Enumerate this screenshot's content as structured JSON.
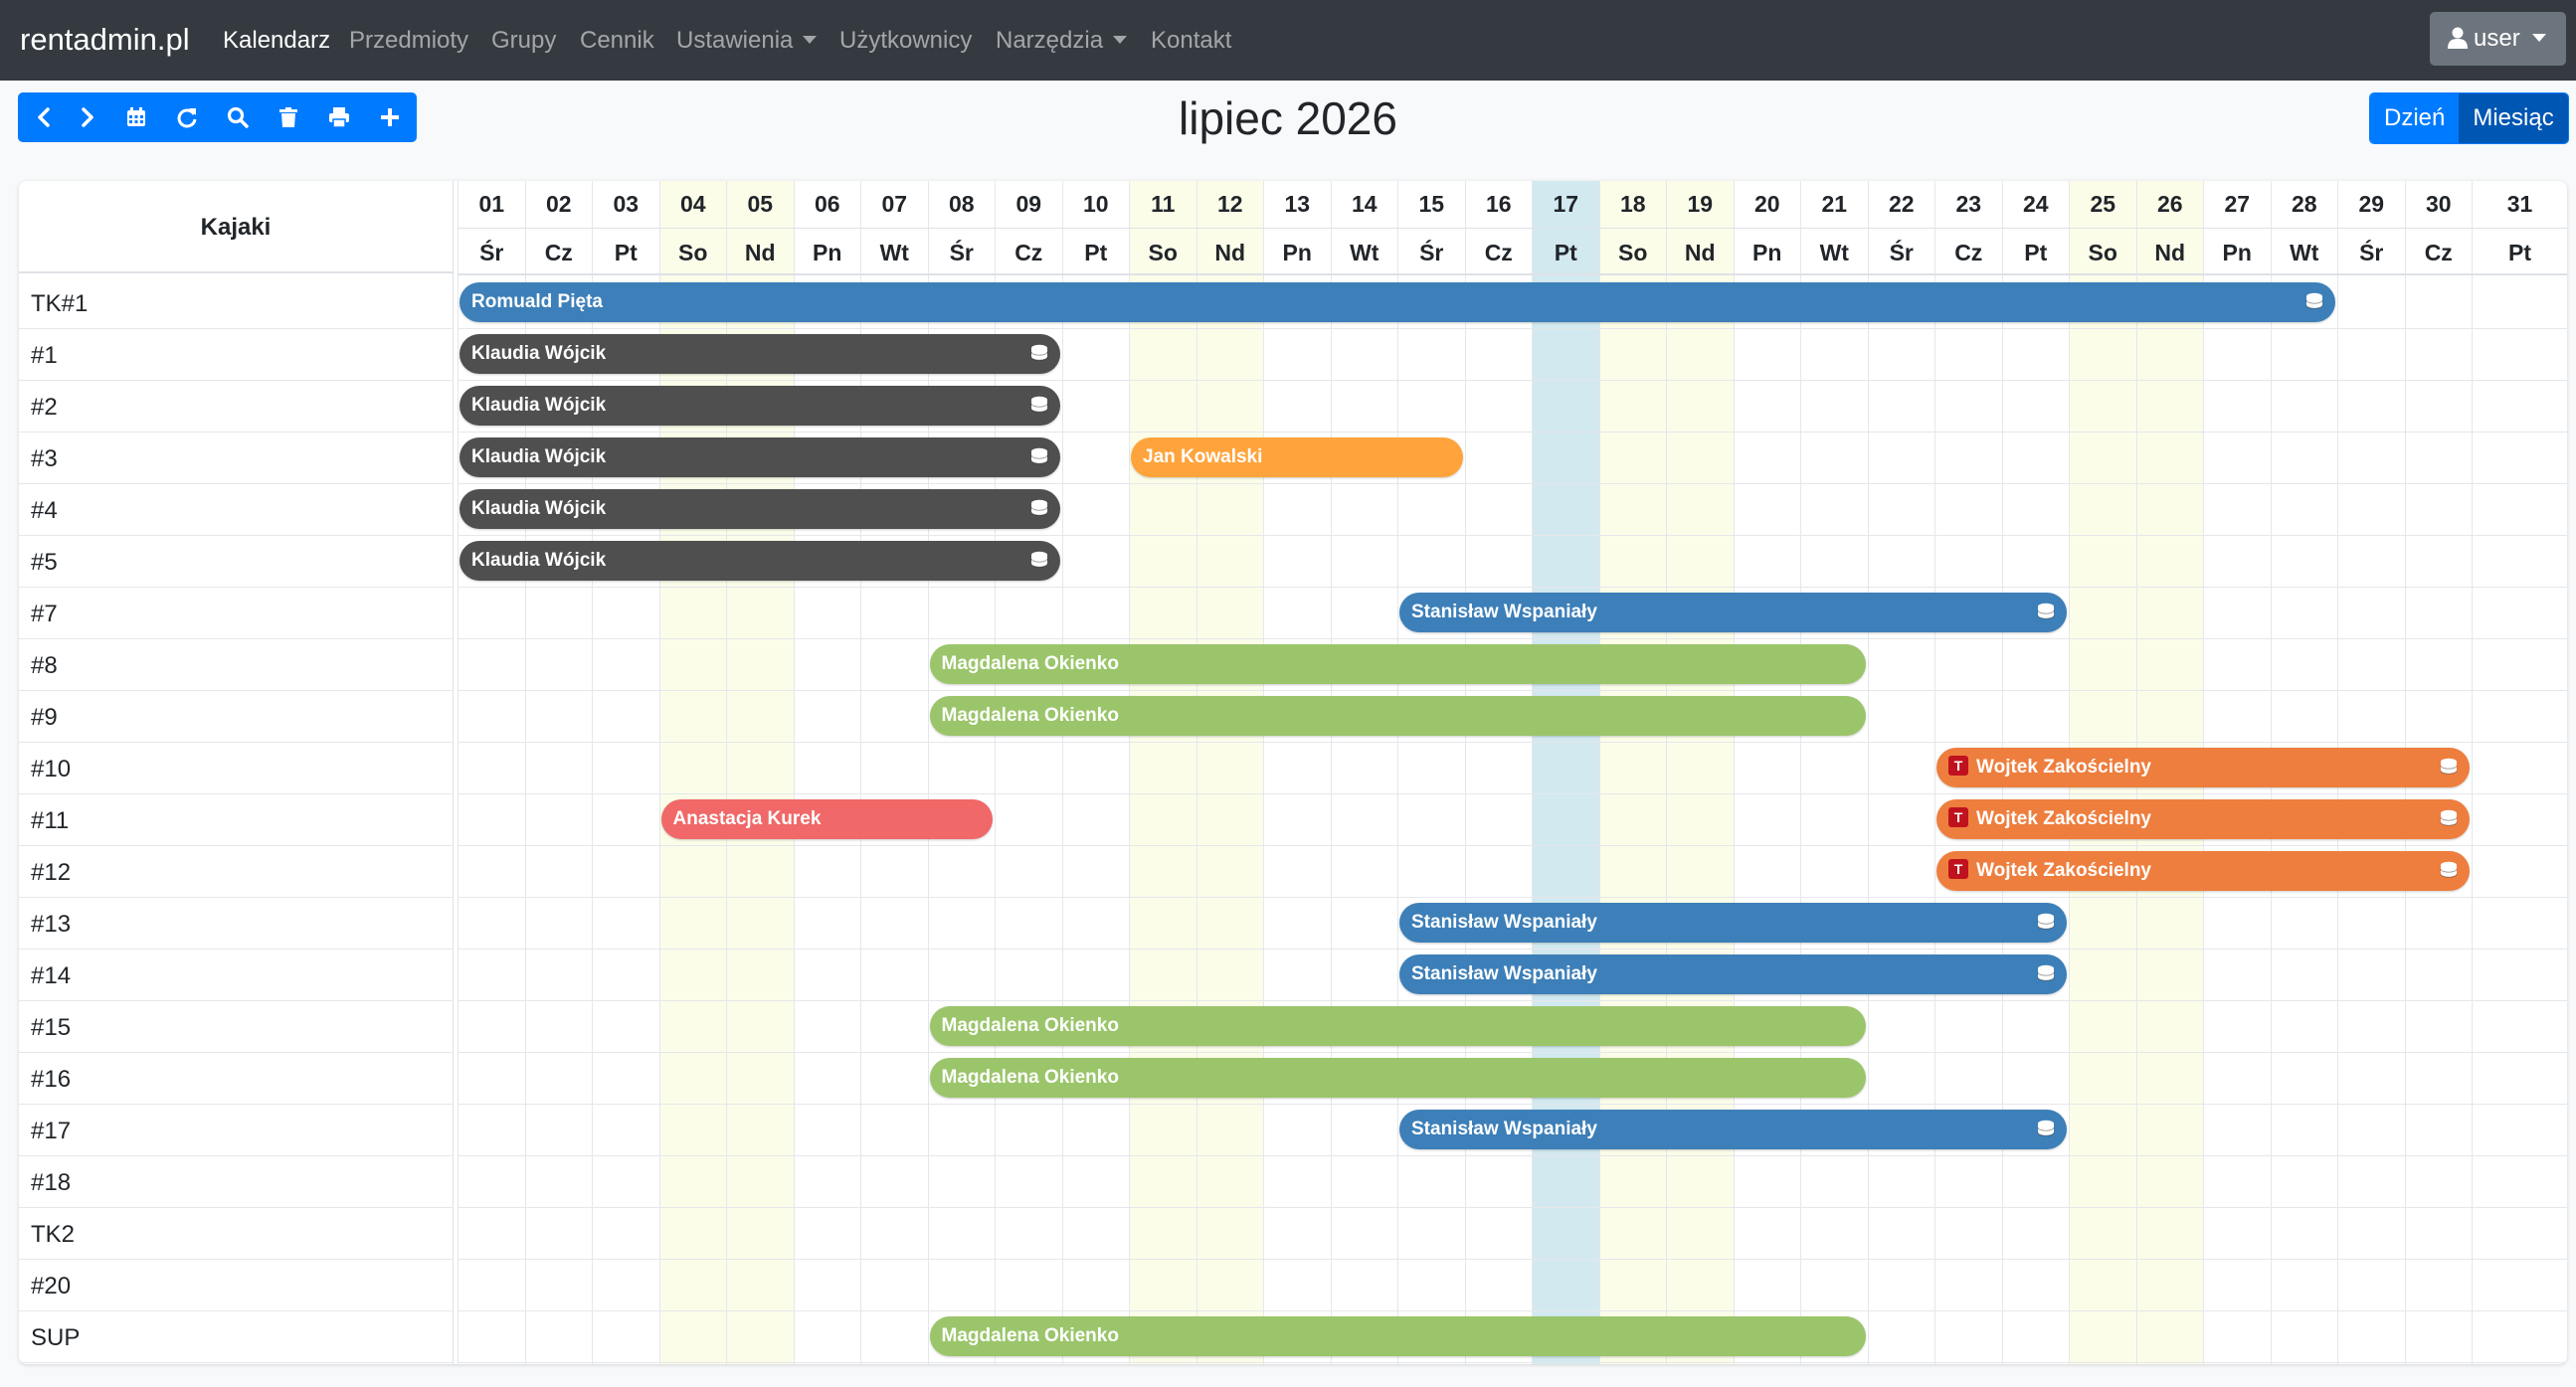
{
  "nav": {
    "brand": "rentadmin.pl",
    "items": [
      {
        "label": "Kalendarz",
        "active": true,
        "dropdown": false
      },
      {
        "label": "Przedmioty",
        "active": false,
        "dropdown": false
      },
      {
        "label": "Grupy",
        "active": false,
        "dropdown": false
      },
      {
        "label": "Cennik",
        "active": false,
        "dropdown": false
      },
      {
        "label": "Ustawienia",
        "active": false,
        "dropdown": true
      },
      {
        "label": "Użytkownicy",
        "active": false,
        "dropdown": false
      },
      {
        "label": "Narzędzia",
        "active": false,
        "dropdown": true
      },
      {
        "label": "Kontakt",
        "active": false,
        "dropdown": false
      }
    ],
    "user_label": "user"
  },
  "toolbar": {
    "buttons": [
      "chevron-left-icon",
      "chevron-right-icon",
      "calendar-icon",
      "refresh-icon",
      "search-icon",
      "trash-icon",
      "print-icon",
      "plus-icon"
    ]
  },
  "title": "lipiec 2026",
  "view_toggle": {
    "day": "Dzień",
    "month": "Miesiąc",
    "active": "month"
  },
  "calendar": {
    "resources_title": "Kajaki",
    "days": [
      {
        "num": "01",
        "name": "Śr"
      },
      {
        "num": "02",
        "name": "Cz"
      },
      {
        "num": "03",
        "name": "Pt"
      },
      {
        "num": "04",
        "name": "So"
      },
      {
        "num": "05",
        "name": "Nd"
      },
      {
        "num": "06",
        "name": "Pn"
      },
      {
        "num": "07",
        "name": "Wt"
      },
      {
        "num": "08",
        "name": "Śr"
      },
      {
        "num": "09",
        "name": "Cz"
      },
      {
        "num": "10",
        "name": "Pt"
      },
      {
        "num": "11",
        "name": "So"
      },
      {
        "num": "12",
        "name": "Nd"
      },
      {
        "num": "13",
        "name": "Pn"
      },
      {
        "num": "14",
        "name": "Wt"
      },
      {
        "num": "15",
        "name": "Śr"
      },
      {
        "num": "16",
        "name": "Cz"
      },
      {
        "num": "17",
        "name": "Pt"
      },
      {
        "num": "18",
        "name": "So"
      },
      {
        "num": "19",
        "name": "Nd"
      },
      {
        "num": "20",
        "name": "Pn"
      },
      {
        "num": "21",
        "name": "Wt"
      },
      {
        "num": "22",
        "name": "Śr"
      },
      {
        "num": "23",
        "name": "Cz"
      },
      {
        "num": "24",
        "name": "Pt"
      },
      {
        "num": "25",
        "name": "So"
      },
      {
        "num": "26",
        "name": "Nd"
      },
      {
        "num": "27",
        "name": "Pn"
      },
      {
        "num": "28",
        "name": "Wt"
      },
      {
        "num": "29",
        "name": "Śr"
      },
      {
        "num": "30",
        "name": "Cz"
      },
      {
        "num": "31",
        "name": "Pt"
      }
    ],
    "today_day": 17,
    "resources": [
      "TK#1",
      "#1",
      "#2",
      "#3",
      "#4",
      "#5",
      "#7",
      "#8",
      "#9",
      "#10",
      "#11",
      "#12",
      "#13",
      "#14",
      "#15",
      "#16",
      "#17",
      "#18",
      "TK2",
      "#20",
      "SUP"
    ],
    "colors": {
      "blue": "#3d7fb8",
      "dark": "#4f4f4f",
      "orange": "#ffa43c",
      "green": "#9bc56a",
      "red": "#f06868",
      "deep_orange": "#ee7e3e"
    },
    "events": [
      {
        "resource": 0,
        "start": 1,
        "end": 28,
        "name": "Romuald Pięta",
        "color": "blue",
        "paid": true,
        "tag": ""
      },
      {
        "resource": 1,
        "start": 1,
        "end": 9,
        "name": "Klaudia Wójcik",
        "color": "dark",
        "paid": true,
        "tag": ""
      },
      {
        "resource": 2,
        "start": 1,
        "end": 9,
        "name": "Klaudia Wójcik",
        "color": "dark",
        "paid": true,
        "tag": ""
      },
      {
        "resource": 3,
        "start": 1,
        "end": 9,
        "name": "Klaudia Wójcik",
        "color": "dark",
        "paid": true,
        "tag": ""
      },
      {
        "resource": 3,
        "start": 11,
        "end": 15,
        "name": "Jan Kowalski",
        "color": "orange",
        "paid": false,
        "tag": ""
      },
      {
        "resource": 4,
        "start": 1,
        "end": 9,
        "name": "Klaudia Wójcik",
        "color": "dark",
        "paid": true,
        "tag": ""
      },
      {
        "resource": 5,
        "start": 1,
        "end": 9,
        "name": "Klaudia Wójcik",
        "color": "dark",
        "paid": true,
        "tag": ""
      },
      {
        "resource": 6,
        "start": 15,
        "end": 24,
        "name": "Stanisław Wspaniały",
        "color": "blue",
        "paid": true,
        "tag": ""
      },
      {
        "resource": 7,
        "start": 8,
        "end": 21,
        "name": "Magdalena Okienko",
        "color": "green",
        "paid": false,
        "tag": ""
      },
      {
        "resource": 8,
        "start": 8,
        "end": 21,
        "name": "Magdalena Okienko",
        "color": "green",
        "paid": false,
        "tag": ""
      },
      {
        "resource": 9,
        "start": 23,
        "end": 30,
        "name": "Wojtek Zakościelny",
        "color": "deep_orange",
        "paid": true,
        "tag": "T"
      },
      {
        "resource": 10,
        "start": 4,
        "end": 8,
        "name": "Anastacja Kurek",
        "color": "red",
        "paid": false,
        "tag": ""
      },
      {
        "resource": 10,
        "start": 23,
        "end": 30,
        "name": "Wojtek Zakościelny",
        "color": "deep_orange",
        "paid": true,
        "tag": "T"
      },
      {
        "resource": 11,
        "start": 23,
        "end": 30,
        "name": "Wojtek Zakościelny",
        "color": "deep_orange",
        "paid": true,
        "tag": "T"
      },
      {
        "resource": 12,
        "start": 15,
        "end": 24,
        "name": "Stanisław Wspaniały",
        "color": "blue",
        "paid": true,
        "tag": ""
      },
      {
        "resource": 13,
        "start": 15,
        "end": 24,
        "name": "Stanisław Wspaniały",
        "color": "blue",
        "paid": true,
        "tag": ""
      },
      {
        "resource": 14,
        "start": 8,
        "end": 21,
        "name": "Magdalena Okienko",
        "color": "green",
        "paid": false,
        "tag": ""
      },
      {
        "resource": 15,
        "start": 8,
        "end": 21,
        "name": "Magdalena Okienko",
        "color": "green",
        "paid": false,
        "tag": ""
      },
      {
        "resource": 16,
        "start": 15,
        "end": 24,
        "name": "Stanisław Wspaniały",
        "color": "blue",
        "paid": true,
        "tag": ""
      },
      {
        "resource": 20,
        "start": 8,
        "end": 21,
        "name": "Magdalena Okienko",
        "color": "green",
        "paid": false,
        "tag": ""
      }
    ]
  }
}
